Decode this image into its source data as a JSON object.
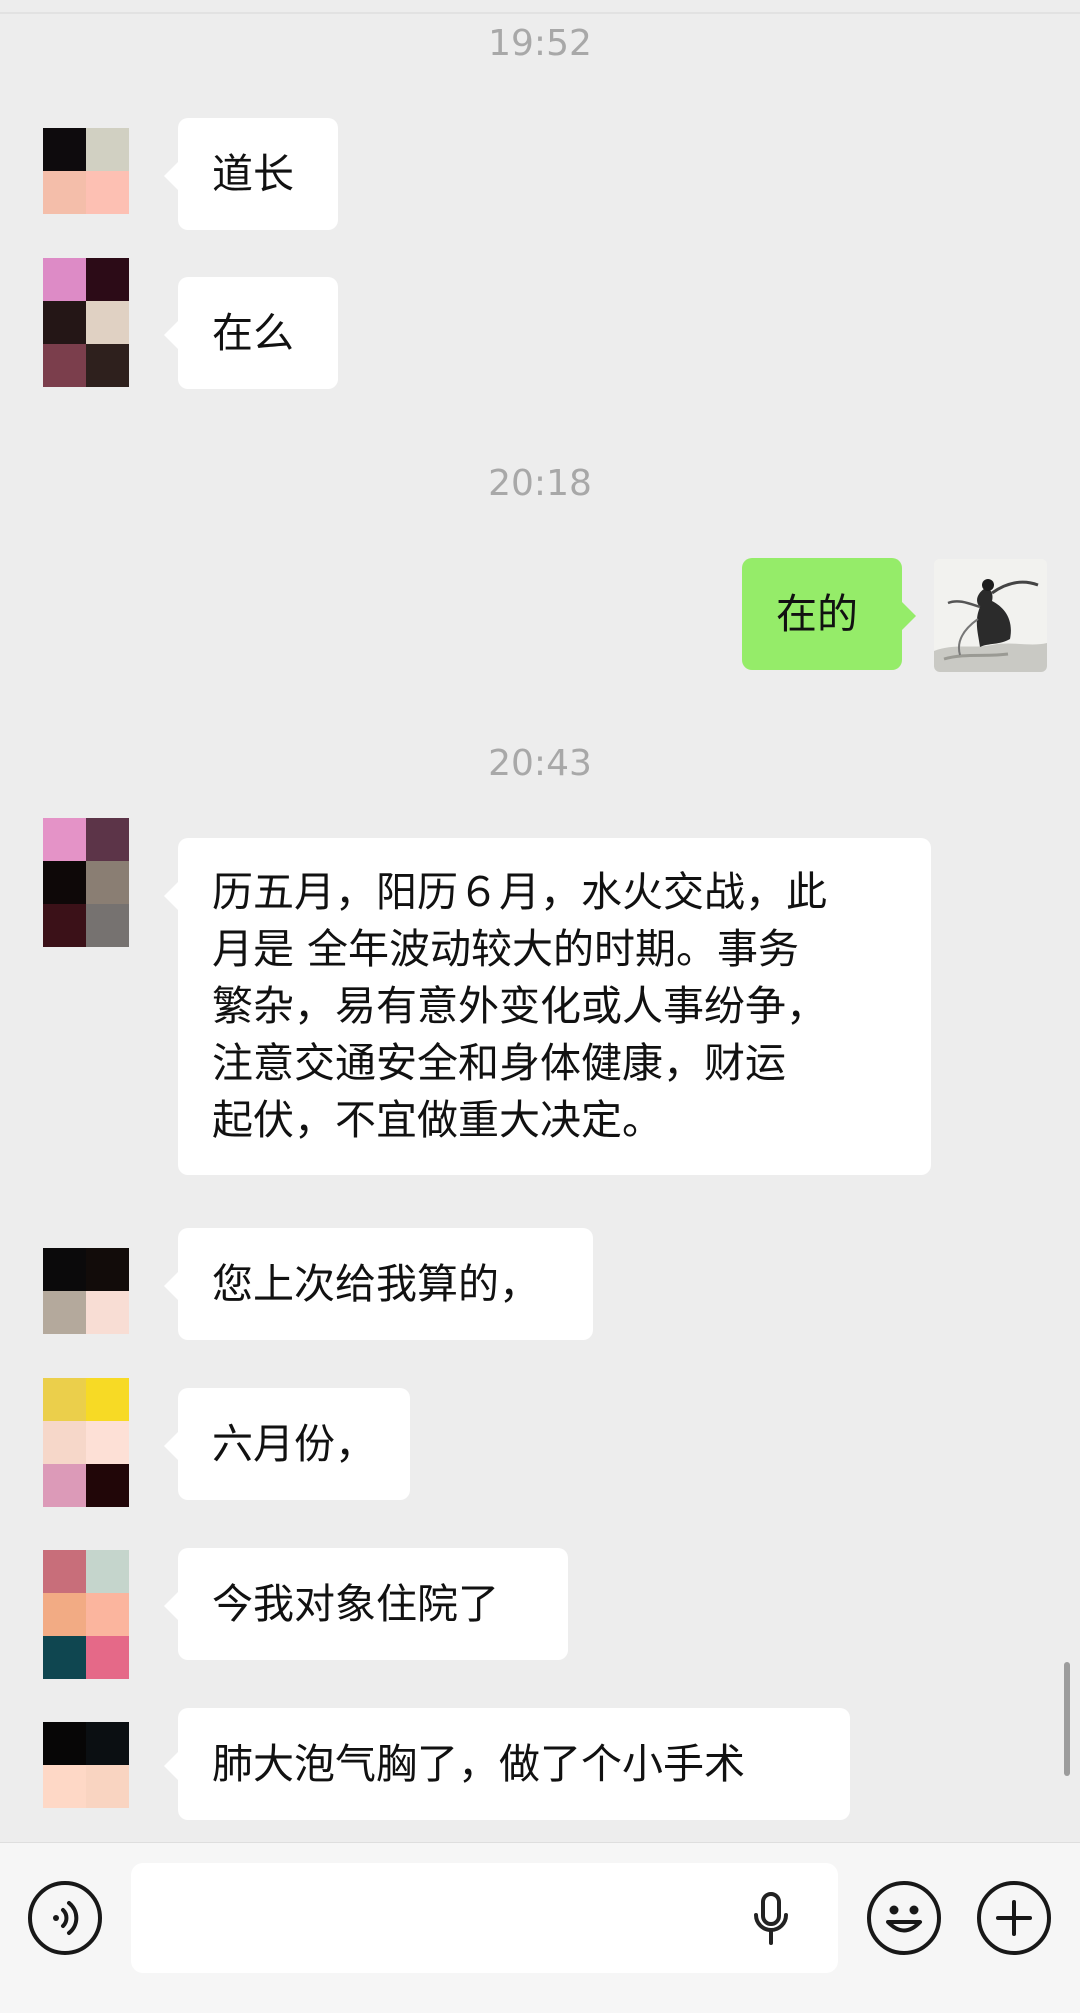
{
  "chat": {
    "timestamps": [
      "19:52",
      "20:18",
      "20:43"
    ],
    "messages": [
      {
        "sender": "other",
        "text": "道长"
      },
      {
        "sender": "other",
        "text": "在么"
      },
      {
        "sender": "self",
        "text": "在的"
      },
      {
        "sender": "other",
        "lines": [
          "历五月，阳历６月，水火交战，此",
          "月是 全年波动较大的时期。事务",
          "繁杂，易有意外变化或人事纷争，",
          "注意交通安全和身体健康，财运",
          "起伏，不宜做重大决定。"
        ]
      },
      {
        "sender": "other",
        "text": "您上次给我算的，"
      },
      {
        "sender": "other",
        "text": "六月份，"
      },
      {
        "sender": "other",
        "text": "今我对象住院了"
      },
      {
        "sender": "other",
        "text": "肺大泡气胸了，做了个小手术"
      }
    ]
  },
  "input_bar": {
    "voice_icon": "voice-mode-icon",
    "mic_icon": "microphone-icon",
    "emoji_icon": "emoji-icon",
    "more_icon": "plus-icon"
  },
  "colors": {
    "background": "#ededed",
    "incoming_bubble": "#ffffff",
    "outgoing_bubble": "#95ec69",
    "timestamp": "#a8a8a8"
  }
}
